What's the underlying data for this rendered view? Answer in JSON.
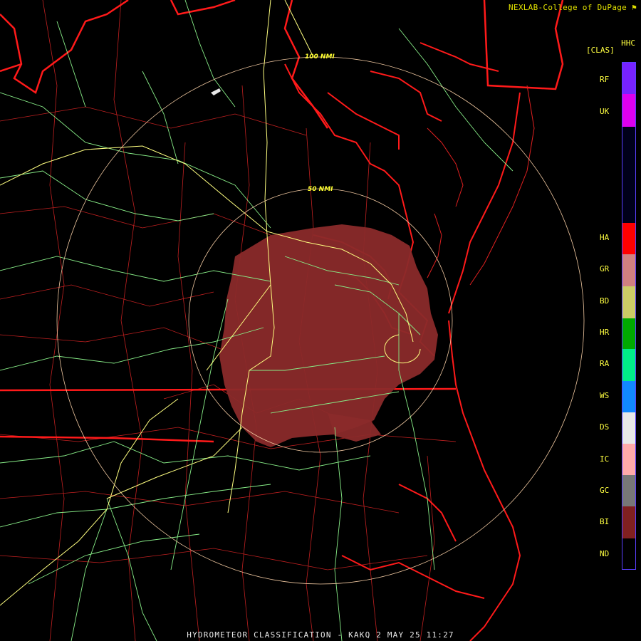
{
  "header": {
    "credit": "NEXLAB-College of DuPage",
    "credit_logo": "nexlab-flag-icon",
    "product_code": "HHC",
    "product_units": "[CLAS]"
  },
  "footer": {
    "title": "HYDROMETEOR CLASSIFICATION - KAKQ 2 MAY 25 11:27"
  },
  "range_rings": {
    "inner_label": "50 NMI",
    "outer_label": "100 NMI"
  },
  "legend": {
    "items": [
      {
        "code": "RF",
        "color": "#7722ff"
      },
      {
        "code": "UK",
        "color": "#dd00ee"
      },
      {
        "code": "HA",
        "color": "#ff0000"
      },
      {
        "code": "GR",
        "color": "#d08080"
      },
      {
        "code": "BD",
        "color": "#cccc66"
      },
      {
        "code": "HR",
        "color": "#00aa00"
      },
      {
        "code": "RA",
        "color": "#00ee88"
      },
      {
        "code": "WS",
        "color": "#1188ff"
      },
      {
        "code": "DS",
        "color": "#e8e8e8"
      },
      {
        "code": "IC",
        "color": "#ffaaaa"
      },
      {
        "code": "GC",
        "color": "#777777"
      },
      {
        "code": "BI",
        "color": "#802020"
      },
      {
        "code": "ND",
        "color": "#000000"
      }
    ]
  },
  "colors": {
    "state_border": "#ff1a1a",
    "county_border": "#cc2222",
    "highway_major": "#ffff80",
    "highway_minor": "#88ee88",
    "range_ring": "#f0c8a0",
    "echo": "#8a2a2a"
  }
}
